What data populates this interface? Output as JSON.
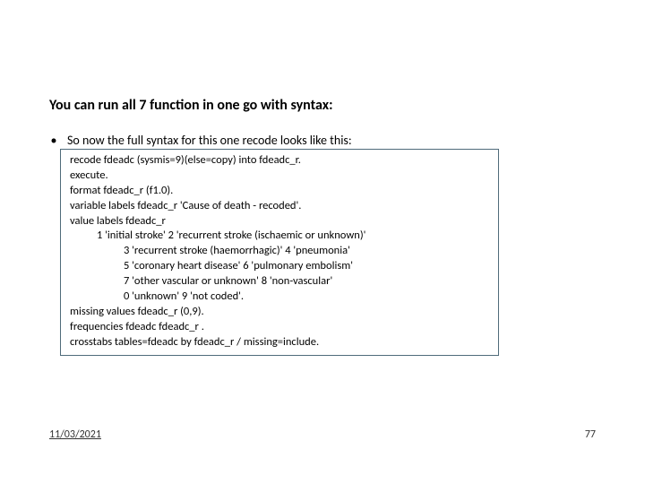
{
  "title": "You can run all 7 function in one go with syntax:",
  "bullet": "So now the full syntax for this one recode looks like this:",
  "code": {
    "l1": "recode fdeadc (sysmis=9)(else=copy) into fdeadc_r.",
    "l2": "execute.",
    "l3": "format fdeadc_r (f1.0).",
    "l4": "variable labels fdeadc_r 'Cause of death - recoded'.",
    "l5": "value labels fdeadc_r",
    "l6": "1 'initial stroke' 2 'recurrent stroke (ischaemic or unknown)'",
    "l7": "3 'recurrent stroke (haemorrhagic)' 4 'pneumonia'",
    "l8": "5 'coronary heart disease' 6 'pulmonary embolism'",
    "l9": "7 'other vascular or unknown' 8 'non-vascular'",
    "l10": "0 'unknown' 9 'not coded'.",
    "l11": "missing values fdeadc_r (0,9).",
    "l12": "frequencies fdeadc fdeadc_r .",
    "l13": "crosstabs tables=fdeadc by fdeadc_r / missing=include."
  },
  "footer": {
    "date": "11/03/2021",
    "page": "77"
  }
}
